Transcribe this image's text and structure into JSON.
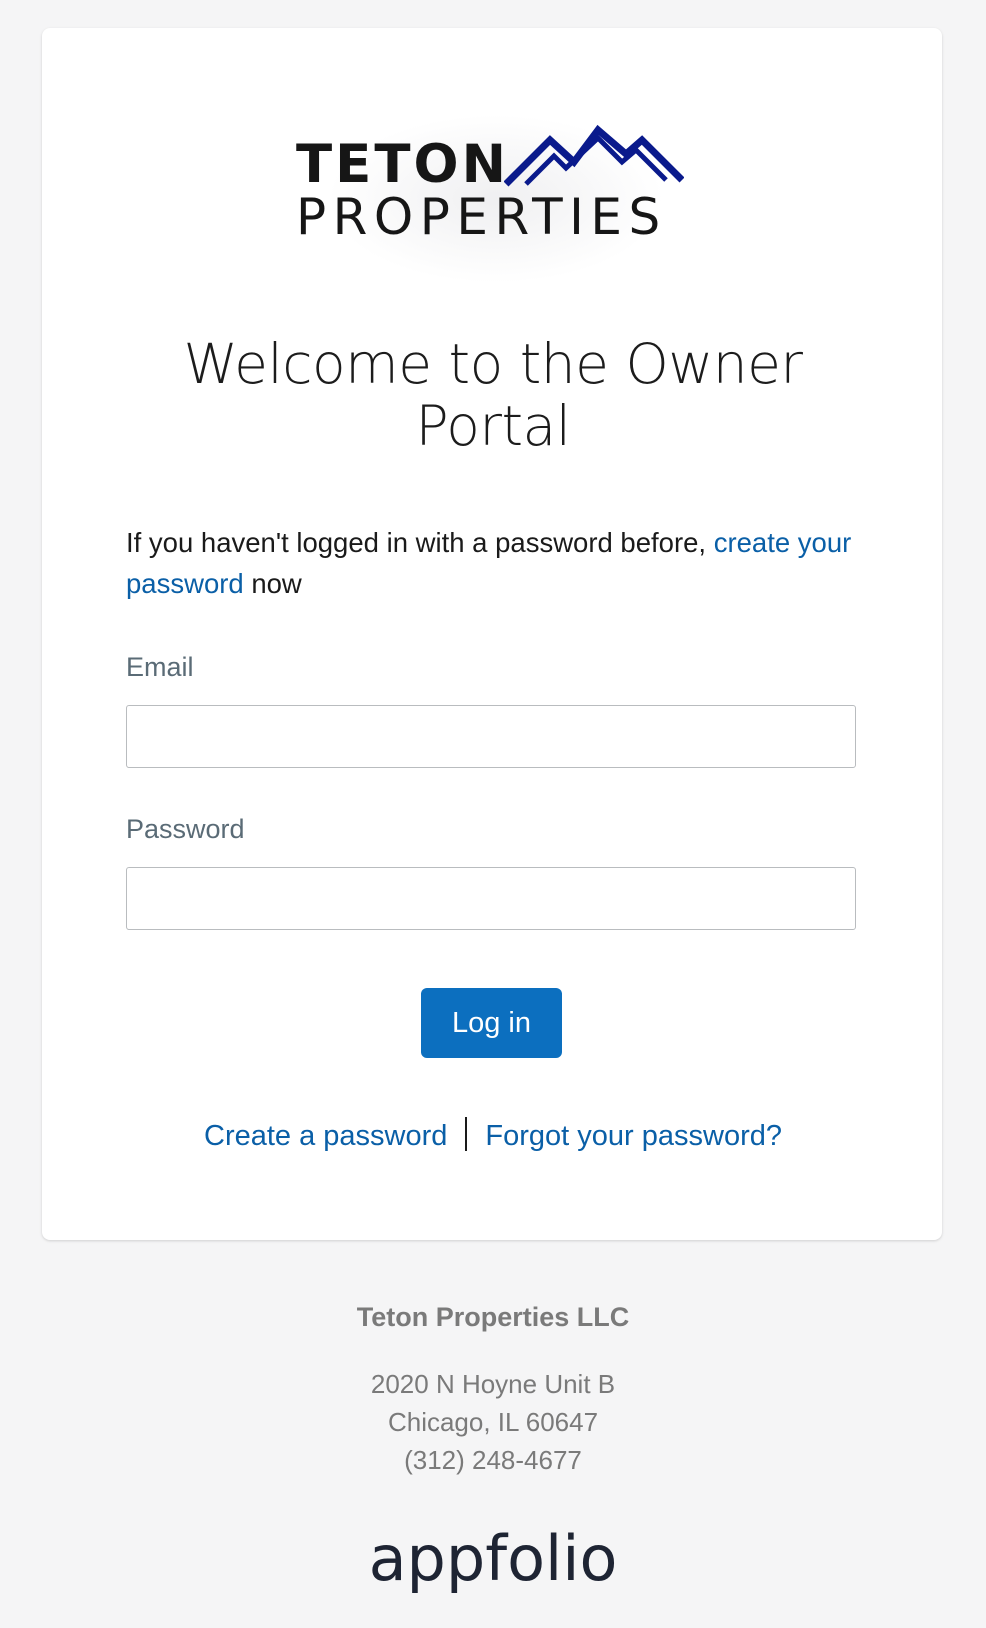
{
  "logo": {
    "line1": "TETON",
    "line2": "PROPERTIES",
    "mountain_color": "#0a1a8c"
  },
  "welcome": {
    "title": "Welcome to the Owner Portal"
  },
  "intro": {
    "prefix": "If you haven't logged in with a password before, ",
    "link": "create your password",
    "suffix": " now"
  },
  "form": {
    "email_label": "Email",
    "email_value": "",
    "password_label": "Password",
    "password_value": "",
    "login_label": "Log in"
  },
  "links": {
    "create_password": "Create a password",
    "forgot_password": "Forgot your password?"
  },
  "footer": {
    "company": "Teton Properties LLC",
    "address_line1": "2020 N Hoyne Unit B",
    "address_line2": "Chicago, IL 60647",
    "phone": "(312) 248-4677",
    "brand": "appfolio"
  },
  "colors": {
    "accent": "#0c6fbf",
    "link": "#0a5fa7",
    "background": "#f5f5f6"
  }
}
